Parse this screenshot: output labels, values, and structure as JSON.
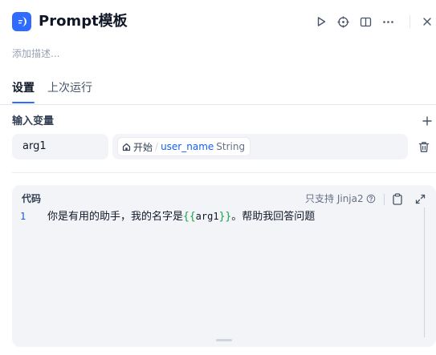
{
  "header": {
    "title": "Prompt模板",
    "icon": "prompt-template-icon",
    "accent": "#2f6bff"
  },
  "description": {
    "placeholder": "添加描述..."
  },
  "tabs": [
    {
      "label": "设置",
      "active": true
    },
    {
      "label": "上次运行",
      "active": false
    }
  ],
  "inputs": {
    "title": "输入变量",
    "variables": [
      {
        "name": "arg1",
        "source_node": "开始",
        "separator": "/",
        "source_var": "user_name",
        "type": "String"
      }
    ]
  },
  "code": {
    "title": "代码",
    "support_note": "只支持 Jinja2",
    "lines": [
      {
        "number": "1",
        "before": "你是有用的助手，我的名字是",
        "open_brace": "{{",
        "var": "arg1",
        "close_brace": "}}",
        "after": "。帮助我回答问题"
      }
    ]
  }
}
